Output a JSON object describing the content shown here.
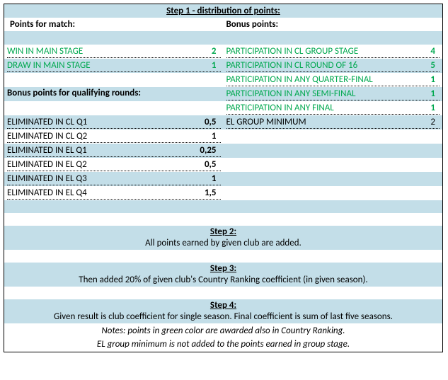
{
  "step1": {
    "title": "Step 1 - distribution of points:",
    "pointsForMatch": {
      "heading": "Points for match:",
      "rows": [
        {
          "label": "WIN IN MAIN STAGE",
          "value": "2"
        },
        {
          "label": "DRAW IN MAIN STAGE",
          "value": "1"
        }
      ]
    },
    "bonusQualifying": {
      "heading": "Bonus points for qualifying rounds:",
      "rows": [
        {
          "label": "ELIMINATED IN CL Q1",
          "value": "0,5"
        },
        {
          "label": "ELIMINATED IN CL Q2",
          "value": "1"
        },
        {
          "label": "ELIMINATED IN EL Q1",
          "value": "0,25"
        },
        {
          "label": "ELIMINATED IN EL Q2",
          "value": "0,5"
        },
        {
          "label": "ELIMINATED IN EL Q3",
          "value": "1"
        },
        {
          "label": "ELIMINATED IN EL Q4",
          "value": "1,5"
        }
      ]
    },
    "bonusPoints": {
      "heading": "Bonus points:",
      "rows": [
        {
          "label": "PARTICIPATION IN CL GROUP STAGE",
          "value": "4",
          "green": true
        },
        {
          "label": "PARTICIPATION IN CL ROUND OF 16",
          "value": "5",
          "green": true
        },
        {
          "label": "PARTICIPATION IN ANY QUARTER-FINAL",
          "value": "1",
          "green": true
        },
        {
          "label": "PARTICIPATION IN ANY SEMI-FINAL",
          "value": "1",
          "green": true
        },
        {
          "label": "PARTICIPATION IN ANY FINAL",
          "value": "1",
          "green": true
        },
        {
          "label": "EL GROUP MINIMUM",
          "value": "2",
          "green": false
        }
      ]
    }
  },
  "step2": {
    "title": "Step 2:",
    "text": "All points earned by given club are added."
  },
  "step3": {
    "title": "Step 3:",
    "text": "Then added 20% of given club's Country Ranking coefficient (in given season)."
  },
  "step4": {
    "title": "Step 4:",
    "text": "Given result is club coefficient for single season. Final coefficient is sum of last five seasons."
  },
  "notes": {
    "line1": "Notes: points in green color are awarded also in Country Ranking.",
    "line2": "EL group minimum is not added to the points earned in group stage."
  }
}
